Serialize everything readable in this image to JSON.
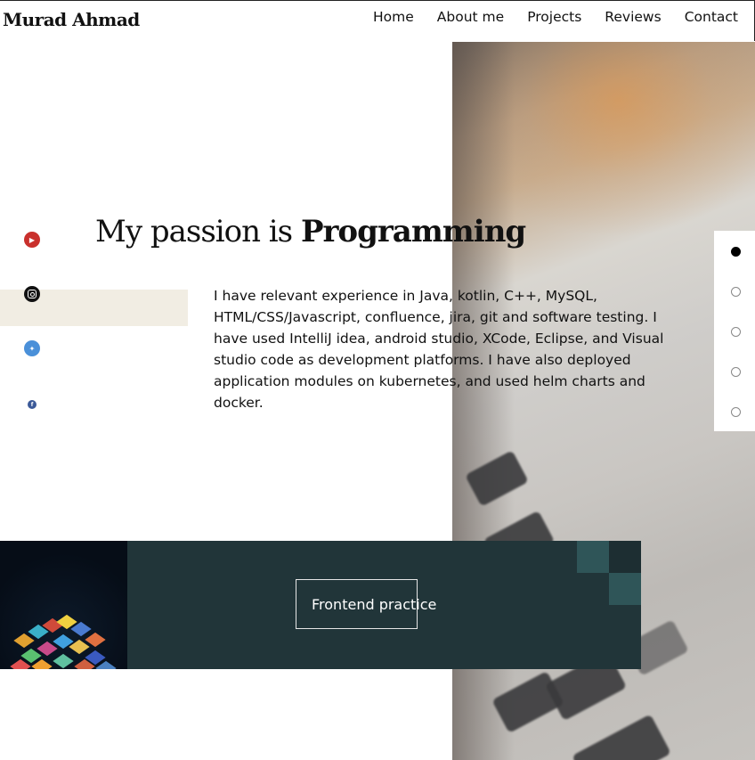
{
  "header": {
    "brand": "Murad Ahmad",
    "nav": [
      "Home",
      "About me",
      "Projects",
      "Reviews",
      "Contact"
    ]
  },
  "hero": {
    "title_prefix": "My passion is ",
    "title_highlight": "Programming",
    "description": "I have relevant experience in Java, kotlin, C++, MySQL, HTML/CSS/Javascript, confluence, jira, git and software testing. I have used IntelliJ idea, android studio, XCode, Eclipse, and Visual studio code as development platforms. I have also deployed application modules on kubernetes, and used helm charts and docker."
  },
  "social": [
    {
      "icon": "youtube-icon",
      "color": "#c9302c"
    },
    {
      "icon": "instagram-icon",
      "color": "#111111"
    },
    {
      "icon": "twitter-icon",
      "color": "#4a90d9"
    },
    {
      "icon": "facebook-icon",
      "color": "#3b5998"
    }
  ],
  "slider": {
    "count": 5,
    "active_index": 0
  },
  "project": {
    "button_label": "Frontend practice",
    "background_color": "#213539"
  },
  "colors": {
    "accent_beige": "#f1ede3",
    "project_bg": "#213539"
  }
}
